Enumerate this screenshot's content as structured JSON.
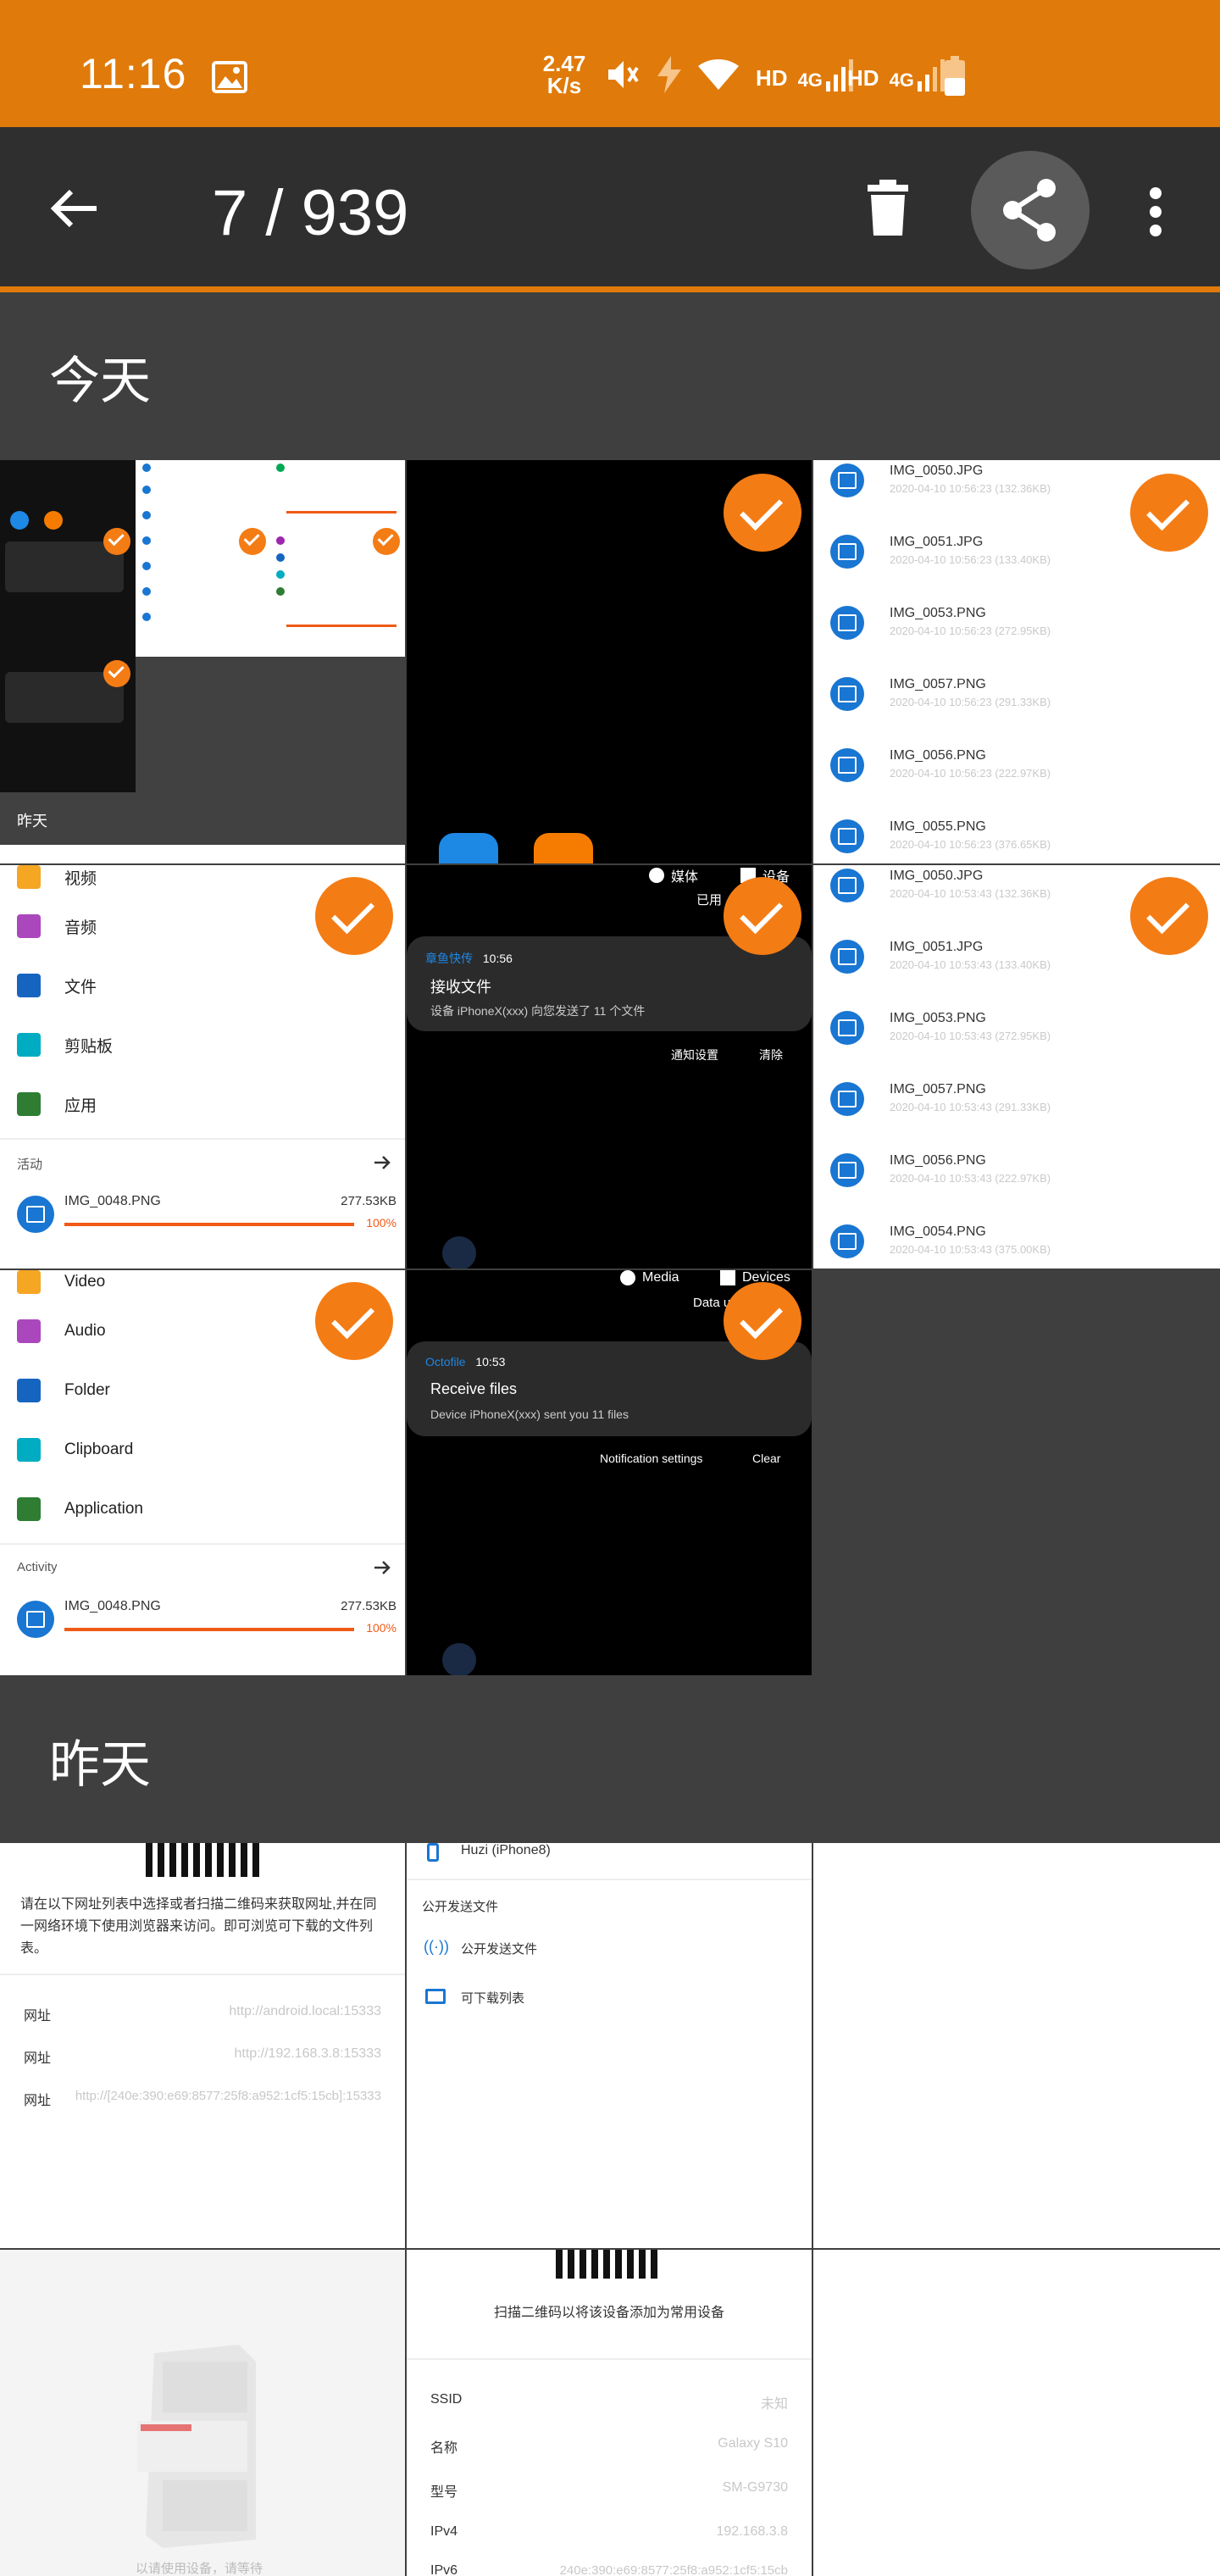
{
  "status_bar": {
    "time": "11:16",
    "net_speed_value": "2.47",
    "net_speed_unit": "K/s",
    "hd1": "HD",
    "net1": "4G",
    "hd2": "HD",
    "net2": "4G"
  },
  "app_bar": {
    "counter": "7 / 939"
  },
  "sections": {
    "today": "今天",
    "yesterday": "昨天"
  },
  "tile1": {
    "yesterday_label": "昨天"
  },
  "file_list": {
    "a": [
      {
        "name": "IMG_0050.JPG",
        "meta": "2020-04-10 10:56:23 (132.36KB)"
      },
      {
        "name": "IMG_0051.JPG",
        "meta": "2020-04-10 10:56:23 (133.40KB)"
      },
      {
        "name": "IMG_0053.PNG",
        "meta": "2020-04-10 10:56:23 (272.95KB)"
      },
      {
        "name": "IMG_0057.PNG",
        "meta": "2020-04-10 10:56:23 (291.33KB)"
      },
      {
        "name": "IMG_0056.PNG",
        "meta": "2020-04-10 10:56:23 (222.97KB)"
      },
      {
        "name": "IMG_0055.PNG",
        "meta": "2020-04-10 10:56:23 (376.65KB)"
      }
    ],
    "b": [
      {
        "name": "IMG_0050.JPG",
        "meta": "2020-04-10 10:53:43 (132.36KB)"
      },
      {
        "name": "IMG_0051.JPG",
        "meta": "2020-04-10 10:53:43 (133.40KB)"
      },
      {
        "name": "IMG_0053.PNG",
        "meta": "2020-04-10 10:53:43 (272.95KB)"
      },
      {
        "name": "IMG_0057.PNG",
        "meta": "2020-04-10 10:53:43 (291.33KB)"
      },
      {
        "name": "IMG_0056.PNG",
        "meta": "2020-04-10 10:53:43 (222.97KB)"
      },
      {
        "name": "IMG_0054.PNG",
        "meta": "2020-04-10 10:53:43 (375.00KB)"
      }
    ]
  },
  "menu_cn": {
    "partial": "视频",
    "items": [
      "音频",
      "文件",
      "剪贴板",
      "应用"
    ],
    "section": "活动",
    "file": "IMG_0048.PNG",
    "size": "277.53KB",
    "progress": "100%"
  },
  "menu_en": {
    "partial": "Video",
    "items": [
      "Audio",
      "Folder",
      "Clipboard",
      "Application"
    ],
    "section": "Activity",
    "file": "IMG_0048.PNG",
    "size": "277.53KB",
    "progress": "100%"
  },
  "notif_cn": {
    "media": "媒体",
    "devices": "设备",
    "partial": "已用",
    "app": "章鱼快传",
    "time": "10:56",
    "title": "接收文件",
    "body": "设备 iPhoneX(xxx) 向您发送了 11 个文件",
    "action1": "通知设置",
    "action2": "清除"
  },
  "notif_en": {
    "media": "Media",
    "devices": "Devices",
    "partial": "Data u",
    "app": "Octofile",
    "time": "10:53",
    "title": "Receive files",
    "body": "Device iPhoneX(xxx) sent you 11 files",
    "action1": "Notification settings",
    "action2": "Clear"
  },
  "yesterday_tile1": {
    "desc": "请在以下网址列表中选择或者扫描二维码来获取网址,并在同一网络环境下使用浏览器来访问。即可浏览可下载的文件列表。",
    "rows": [
      {
        "k": "网址",
        "v": "http://android.local:15333"
      },
      {
        "k": "网址",
        "v": "http://192.168.3.8:15333"
      },
      {
        "k": "网址",
        "v": "http://[240e:390:e69:8577:25f8:a952:1cf5:15cb]:15333"
      }
    ]
  },
  "yesterday_tile2": {
    "device": "Huzi (iPhone8)",
    "section": "公开发送文件",
    "item1": "公开发送文件",
    "item2": "可下载列表"
  },
  "yesterday_tile4": {
    "caption": "以请使用设备，请等待"
  },
  "yesterday_tile5": {
    "scan_text": "扫描二维码以将该设备添加为常用设备",
    "rows": [
      {
        "k": "SSID",
        "v": "未知"
      },
      {
        "k": "名称",
        "v": "Galaxy S10"
      },
      {
        "k": "型号",
        "v": "SM-G9730"
      },
      {
        "k": "IPv4",
        "v": "192.168.3.8"
      },
      {
        "k": "IPv6",
        "v": "240e:390:e69:8577:25f8:a952:1cf5:15cb"
      }
    ]
  },
  "colors": {
    "accent": "#e07a0a",
    "check": "#f47c14",
    "appbar": "#2f2f2f",
    "background": "#3f3f3f",
    "file_icon": "#1976d2"
  }
}
